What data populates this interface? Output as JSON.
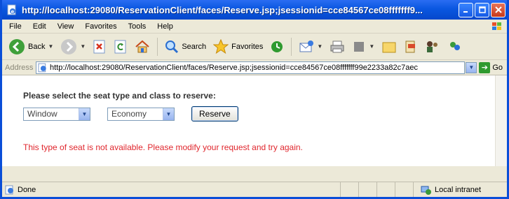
{
  "window": {
    "title": "http://localhost:29080/ReservationClient/faces/Reserve.jsp;jsessionid=cce84567ce08fffffff9..."
  },
  "menu": {
    "items": [
      "File",
      "Edit",
      "View",
      "Favorites",
      "Tools",
      "Help"
    ]
  },
  "toolbar": {
    "back_label": "Back",
    "search_label": "Search",
    "favorites_label": "Favorites"
  },
  "address": {
    "label": "Address",
    "url": "http://localhost:29080/ReservationClient/faces/Reserve.jsp;jsessionid=cce84567ce08fffffff99e2233a82c7aec",
    "go_label": "Go"
  },
  "form": {
    "prompt": "Please select the seat type and class to reserve:",
    "seat_type_value": "Window",
    "class_value": "Economy",
    "reserve_label": "Reserve",
    "error_message": "This type of seat is not available. Please modify your request and try again."
  },
  "status": {
    "left_text": "Done",
    "zone_text": "Local intranet"
  },
  "colors": {
    "titlebar": "#0a57e0",
    "error_text": "#e0262d",
    "chrome_bg": "#ece9d8"
  }
}
